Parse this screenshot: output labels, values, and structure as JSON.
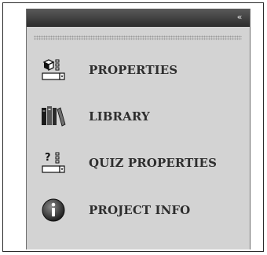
{
  "panel": {
    "collapse_glyph": "«",
    "items": [
      {
        "label": "PROPERTIES",
        "icon": "properties-icon"
      },
      {
        "label": "LIBRARY",
        "icon": "library-icon"
      },
      {
        "label": "QUIZ PROPERTIES",
        "icon": "quiz-properties-icon"
      },
      {
        "label": "PROJECT INFO",
        "icon": "project-info-icon"
      }
    ]
  }
}
